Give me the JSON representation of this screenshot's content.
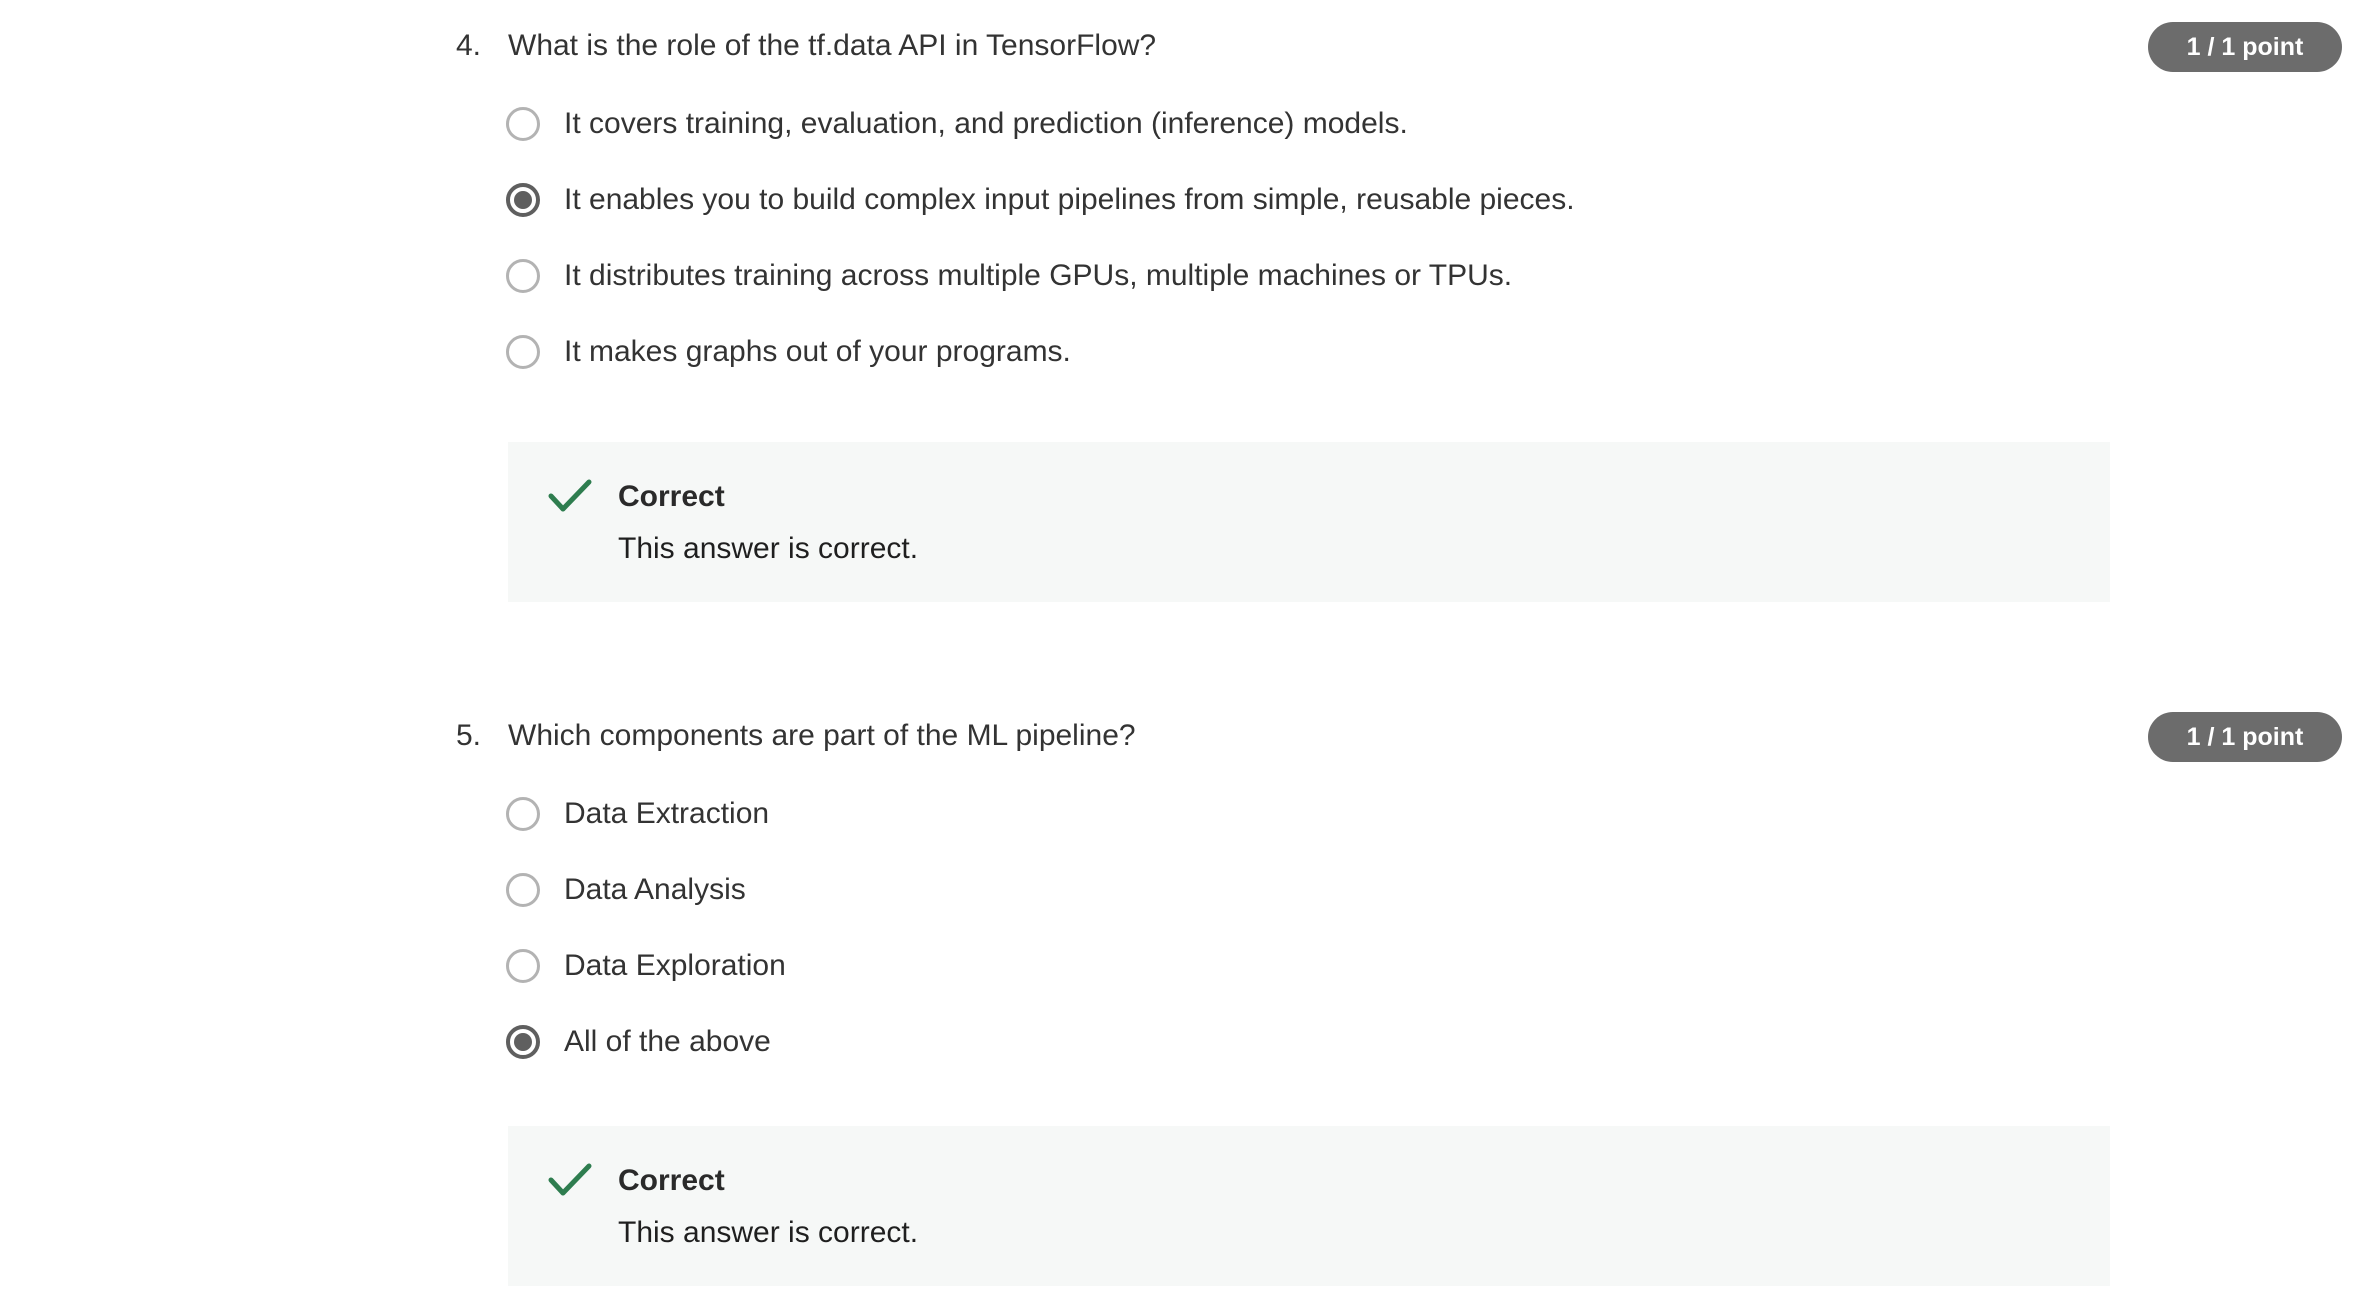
{
  "questions": [
    {
      "number": "4.",
      "text": "What is the role of the tf.data API in TensorFlow?",
      "points": "1 / 1 point",
      "options": [
        {
          "label": "It covers training, evaluation, and prediction (inference) models.",
          "selected": false
        },
        {
          "label": "It enables you to build complex input pipelines from simple, reusable pieces.",
          "selected": true
        },
        {
          "label": "It distributes training across multiple GPUs, multiple machines or TPUs.",
          "selected": false
        },
        {
          "label": "It makes graphs out of your programs.",
          "selected": false
        }
      ],
      "feedback": {
        "icon": "check-icon",
        "title": "Correct",
        "text": "This answer is correct."
      }
    },
    {
      "number": "5.",
      "text": "Which components are part of the ML pipeline?",
      "points": "1 / 1 point",
      "options": [
        {
          "label": "Data Extraction",
          "selected": false
        },
        {
          "label": "Data Analysis",
          "selected": false
        },
        {
          "label": "Data Exploration",
          "selected": false
        },
        {
          "label": "All of the above",
          "selected": true
        }
      ],
      "feedback": {
        "icon": "check-icon",
        "title": "Correct",
        "text": "This answer is correct."
      }
    }
  ],
  "colors": {
    "correct_green": "#2e7d4f",
    "badge_bg": "#6c6c6c",
    "feedback_bg": "#f6f8f7"
  }
}
